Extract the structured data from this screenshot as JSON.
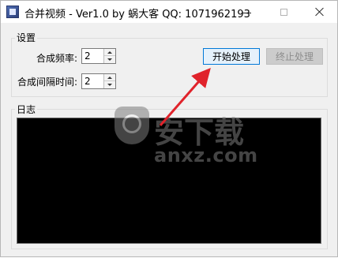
{
  "window": {
    "title": "合并视频 - Ver1.0 by 蜗大客 QQ:  1071962193",
    "controls": {
      "minimize_icon": "minimize-icon",
      "maximize_icon": "maximize-icon",
      "close_icon": "close-icon"
    }
  },
  "settings": {
    "group_label": "设置",
    "frequency": {
      "label": "合成频率:",
      "value": "2"
    },
    "interval": {
      "label": "合成间隔时间:",
      "value": "2"
    },
    "buttons": {
      "start_label": "开始处理",
      "stop_label": "终止处理"
    }
  },
  "log": {
    "group_label": "日志",
    "content": ""
  },
  "watermark": {
    "logo_text": "安下载",
    "url": "anxz.com"
  },
  "colors": {
    "log_background": "#000000",
    "arrow": "#e0232b",
    "start_button_border": "#0078d7",
    "disabled_button_bg": "#cccccc"
  }
}
